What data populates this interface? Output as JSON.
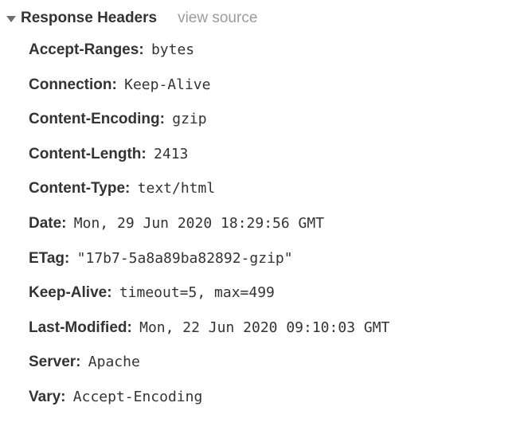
{
  "section": {
    "title": "Response Headers",
    "view_source_label": "view source"
  },
  "headers": [
    {
      "name": "Accept-Ranges:",
      "value": "bytes"
    },
    {
      "name": "Connection:",
      "value": "Keep-Alive"
    },
    {
      "name": "Content-Encoding:",
      "value": "gzip"
    },
    {
      "name": "Content-Length:",
      "value": "2413"
    },
    {
      "name": "Content-Type:",
      "value": "text/html"
    },
    {
      "name": "Date:",
      "value": "Mon, 29 Jun 2020 18:29:56 GMT"
    },
    {
      "name": "ETag:",
      "value": "\"17b7-5a8a89ba82892-gzip\""
    },
    {
      "name": "Keep-Alive:",
      "value": "timeout=5, max=499"
    },
    {
      "name": "Last-Modified:",
      "value": "Mon, 22 Jun 2020 09:10:03 GMT"
    },
    {
      "name": "Server:",
      "value": "Apache"
    },
    {
      "name": "Vary:",
      "value": "Accept-Encoding"
    }
  ]
}
